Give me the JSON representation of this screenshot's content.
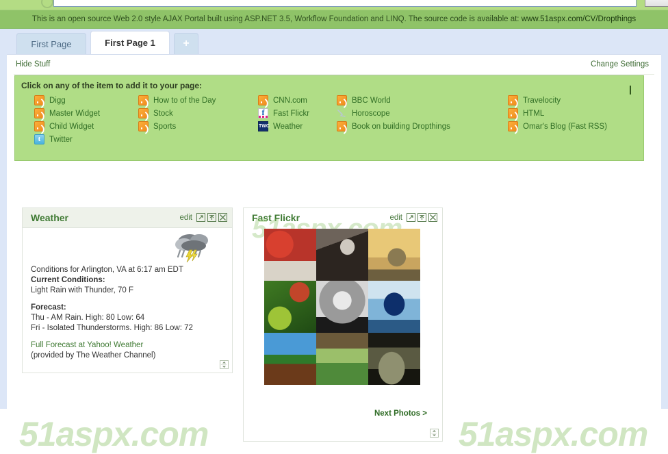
{
  "top": {
    "search_value": "",
    "search_placeholder": "",
    "search_button_label": "",
    "spinner_icon": "loading-spinner-icon"
  },
  "banner": {
    "text_before": "This is an open source Web 2.0 style AJAX Portal built using ASP.NET 3.5, Workflow Foundation and LINQ. The source code is available at: ",
    "link": "www.51aspx.com/CV/Dropthings"
  },
  "tabs": [
    {
      "label": "First Page",
      "active": false
    },
    {
      "label": "First Page 1",
      "active": true
    }
  ],
  "add_tab": {
    "icon": "plus-icon",
    "label": "+"
  },
  "toolbar": {
    "hide_stuff_label": "Hide Stuff",
    "change_settings_label": "Change Settings"
  },
  "gallery": {
    "title": "Click on any of the item to add it to your page:",
    "columns": [
      {
        "items": [
          {
            "label": "Digg",
            "icon": "rss-icon"
          },
          {
            "label": "Master Widget",
            "icon": "rss-icon"
          },
          {
            "label": "Child Widget",
            "icon": "rss-icon"
          },
          {
            "label": "Twitter",
            "icon": "twitter-icon"
          }
        ]
      },
      {
        "items": [
          {
            "label": "How to of the Day",
            "icon": "rss-icon"
          },
          {
            "label": "Stock",
            "icon": "rss-icon"
          },
          {
            "label": "Sports",
            "icon": "rss-icon"
          }
        ]
      },
      {
        "items": [
          {
            "label": "CNN.com",
            "icon": "rss-icon"
          },
          {
            "label": "Fast Flickr",
            "icon": "flickr-icon"
          },
          {
            "label": "Weather",
            "icon": "twc-icon"
          }
        ]
      },
      {
        "items": [
          {
            "label": "BBC World",
            "icon": "rss-icon"
          },
          {
            "label": "Horoscope",
            "icon": "broken-image-icon"
          },
          {
            "label": "Book on building Dropthings",
            "icon": "rss-icon"
          }
        ]
      },
      {
        "items": [
          {
            "label": "Travelocity",
            "icon": "rss-icon"
          },
          {
            "label": "HTML",
            "icon": "rss-icon"
          },
          {
            "label": "Omar's Blog (Fast RSS)",
            "icon": "rss-icon"
          }
        ]
      }
    ]
  },
  "widgets": {
    "weather": {
      "title": "Weather",
      "tools": {
        "edit_label": "edit",
        "restore_icon": "restore-icon",
        "collapse_icon": "collapse-icon",
        "close_icon": "close-icon"
      },
      "weather_icon": "thunderstorm-rain-icon",
      "conditions_line": "Conditions for Arlington, VA at 6:17 am EDT",
      "current_heading": "Current Conditions:",
      "current_value": "Light Rain with Thunder, 70 F",
      "forecast_heading": "Forecast:",
      "forecast_lines": [
        "Thu - AM Rain. High: 80 Low: 64",
        "Fri - Isolated Thunderstorms. High: 86 Low: 72"
      ],
      "full_forecast_link": "Full Forecast at Yahoo! Weather",
      "provider_note": "(provided by The Weather Channel)",
      "resize_icon": "resize-grip-icon"
    },
    "flickr": {
      "title": "Fast Flickr",
      "tools": {
        "edit_label": "edit",
        "restore_icon": "restore-icon",
        "collapse_icon": "collapse-icon",
        "close_icon": "close-icon"
      },
      "photos": [
        {
          "alt": "red temple with white stairs",
          "c1": "#b8342a",
          "c2": "#d9d3c8",
          "c3": "#8e2a22"
        },
        {
          "alt": "dark rock with climber",
          "c1": "#2c2520",
          "c2": "#6d635a",
          "c3": "#15110e"
        },
        {
          "alt": "woman sitting at sunset beach",
          "c1": "#e8c877",
          "c2": "#8a7a52",
          "c3": "#c9a55f"
        },
        {
          "alt": "green plant with red bokeh",
          "c1": "#3f7a22",
          "c2": "#c2452a",
          "c3": "#9ec437"
        },
        {
          "alt": "silhouette of child with stick",
          "c1": "#9a9a9a",
          "c2": "#1a1a1a",
          "c3": "#d6d6d6"
        },
        {
          "alt": "wine glass with ocean inside",
          "c1": "#7fb4d8",
          "c2": "#0d2f6b",
          "c3": "#cfe3ef"
        },
        {
          "alt": "field with blue sky",
          "c1": "#4a9ad6",
          "c2": "#6b3a1a",
          "c3": "#2f7a2a"
        },
        {
          "alt": "tropical bay landscape",
          "c1": "#6b5a3a",
          "c2": "#4f8a3a",
          "c3": "#9bbf6a"
        },
        {
          "alt": "person sleeping under blanket",
          "c1": "#1a1a14",
          "c2": "#8f9070",
          "c3": "#5a5a42"
        }
      ],
      "next_photos_label": "Next Photos >",
      "resize_icon": "resize-grip-icon"
    }
  },
  "watermarks": [
    "51aspx.com",
    "51aspx.com",
    "51aspx.com",
    "51aspx.com",
    "51aspx.com"
  ]
}
